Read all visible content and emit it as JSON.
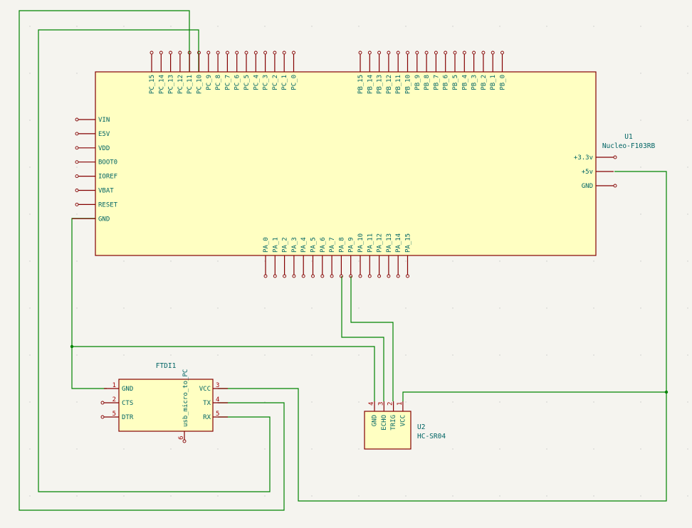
{
  "u1": {
    "ref": "U1",
    "value": "Nucleo-F103RB",
    "pins_top_left": [
      "PC_15",
      "PC_14",
      "PC_13",
      "PC_12",
      "PC_11",
      "PC_10",
      "PC_9",
      "PC_8",
      "PC_7",
      "PC_6",
      "PC_5",
      "PC_4",
      "PC_3",
      "PC_2",
      "PC_1",
      "PC_0"
    ],
    "pins_top_right": [
      "PB_15",
      "PB_14",
      "PB_13",
      "PB_12",
      "PB_11",
      "PB_10",
      "PB_9",
      "PB_8",
      "PB_7",
      "PB_6",
      "PB_5",
      "PB_4",
      "PB_3",
      "PB_2",
      "PB_1",
      "PB_0"
    ],
    "pins_bottom": [
      "PA_0",
      "PA_1",
      "PA_2",
      "PA_3",
      "PA_4",
      "PA_5",
      "PA_6",
      "PA_7",
      "PA_8",
      "PA_9",
      "PA_10",
      "PA_11",
      "PA_12",
      "PA_13",
      "PA_14",
      "PA_15"
    ],
    "pins_left": [
      "VIN",
      "E5V",
      "VDD",
      "BOOT0",
      "IOREF",
      "VBAT",
      "RESET",
      "GND"
    ],
    "pins_right": [
      "+3.3v",
      "+5v",
      "GND"
    ]
  },
  "ftdi": {
    "ref": "FTDI1",
    "value": "usb_micro_to_PC",
    "pins_left": [
      {
        "num": "1",
        "name": "GND"
      },
      {
        "num": "2",
        "name": "CTS"
      },
      {
        "num": "5",
        "name": "DTR"
      }
    ],
    "pins_right": [
      {
        "num": "3",
        "name": "VCC"
      },
      {
        "num": "4",
        "name": "TX"
      },
      {
        "num": "5",
        "name": "RX"
      }
    ],
    "pin_bottom": {
      "num": "6"
    }
  },
  "u2": {
    "ref": "U2",
    "value": "HC-SR04",
    "pins": [
      {
        "num": "4",
        "name": "GND"
      },
      {
        "num": "3",
        "name": "ECHO"
      },
      {
        "num": "2",
        "name": "TRIG"
      },
      {
        "num": "1",
        "name": "VCC"
      }
    ]
  }
}
